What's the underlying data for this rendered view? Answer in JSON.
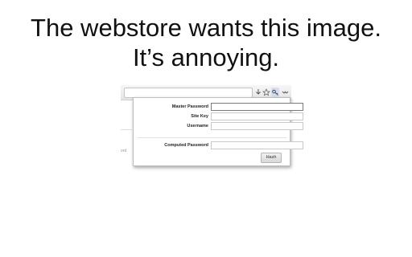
{
  "headline": {
    "line1": "The webstore wants this image.",
    "line2": "It’s annoying."
  },
  "screenshot": {
    "toolbar_icons": [
      "download-icon",
      "star-icon",
      "key-icon",
      "menu-icon"
    ],
    "background_fragment": "ord",
    "popup": {
      "fields": [
        {
          "label": "Master Password",
          "value": "",
          "focused": true
        },
        {
          "label": "Site Key",
          "value": ""
        },
        {
          "label": "Username",
          "value": ""
        },
        {
          "label": "Computed Password",
          "value": ""
        }
      ],
      "hash_button": "Hash"
    }
  }
}
